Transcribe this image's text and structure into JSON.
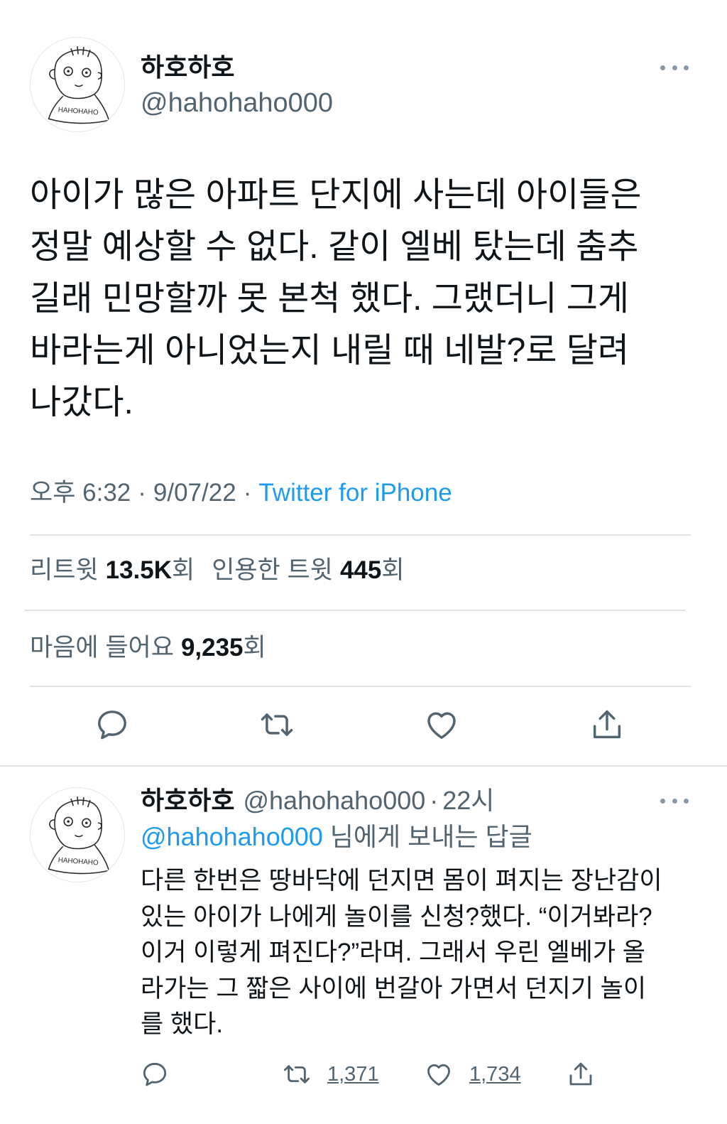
{
  "colors": {
    "text": "#0f1419",
    "secondary": "#536471",
    "accent": "#1d9bf0",
    "divider": "#dfe3e6"
  },
  "main_tweet": {
    "author": {
      "name": "하호하호",
      "handle": "@hahohaho000",
      "avatar_text": "HAHOHAHO"
    },
    "text_lines": [
      "아이가 많은 아파트 단지에 사는데 아이들은",
      "정말 예상할 수 없다. 같이 엘베 탔는데 춤추",
      "길래 민망할까 못 본척 했다. 그랬더니 그게",
      "바라는게 아니었는지 내릴 때 네발?로 달려",
      "나갔다."
    ],
    "meta": {
      "time": "오후 6:32",
      "separator": "·",
      "date": "9/07/22",
      "source": "Twitter for iPhone"
    },
    "stats": {
      "retweets_label": "리트윗",
      "retweets_count": "13.5K",
      "quotes_label": "인용한 트윗",
      "quotes_count": "445",
      "likes_label": "마음에 들어요",
      "likes_count": "9,235",
      "unit": "회"
    },
    "icons": {
      "more": "more-icon",
      "actions": [
        "reply-icon",
        "retweet-icon",
        "heart-icon",
        "share-icon"
      ]
    }
  },
  "reply_tweet": {
    "author": {
      "name": "하호하호",
      "handle": "@hahohaho000",
      "avatar_text": "HAHOHAHO"
    },
    "separator": "·",
    "time": "22시",
    "replying_to": {
      "handle": "@hahohaho000",
      "label": "님에게 보내는 답글"
    },
    "text_lines": [
      "다른 한번은 땅바닥에 던지면 몸이 펴지는 장난감이",
      "있는 아이가 나에게 놀이를 신청?했다. “이거봐라?",
      "이거 이렇게 펴진다?”라며. 그래서 우린 엘베가 올",
      "라가는 그 짧은 사이에 번갈아 가면서 던지기 놀이",
      "를 했다."
    ],
    "actions": {
      "retweets": "1,371",
      "likes": "1,734"
    }
  }
}
